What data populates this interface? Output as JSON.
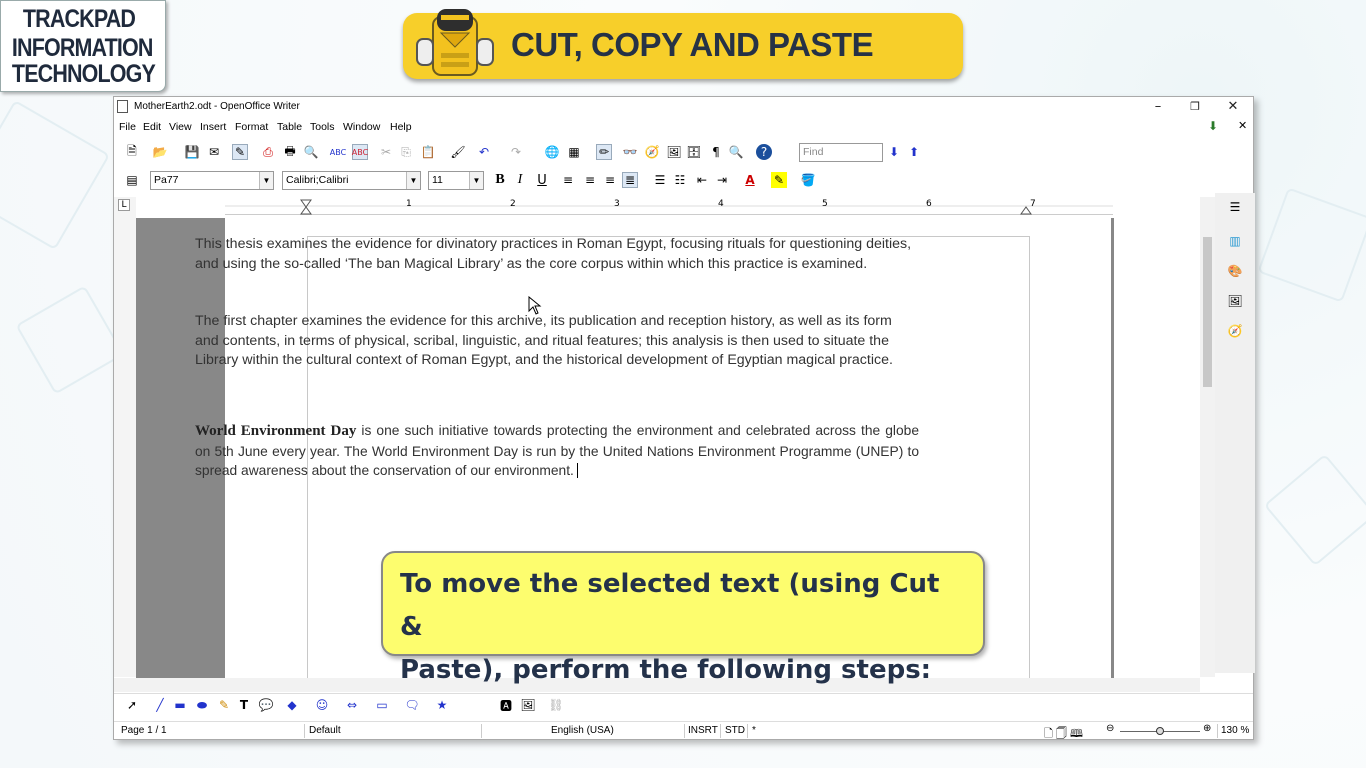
{
  "branding": {
    "logo_line1": "TRACKPAD",
    "logo_line2": "INFORMATION",
    "logo_line3": "TECHNOLOGY",
    "banner_title": "CUT, COPY AND PASTE"
  },
  "window": {
    "title": "MotherEarth2.odt - OpenOffice Writer",
    "minimize": "–",
    "restore": "❐",
    "close": "✕",
    "doc_close": "✕"
  },
  "menu": [
    "File",
    "Edit",
    "View",
    "Insert",
    "Format",
    "Table",
    "Tools",
    "Window",
    "Help"
  ],
  "toolbar": {
    "find_placeholder": "Find"
  },
  "formatting": {
    "style": "Pa77",
    "font": "Calibri;Calibri",
    "size": "11",
    "bold": "B",
    "italic": "I",
    "underline": "U"
  },
  "ruler": {
    "numbers": [
      "1",
      "2",
      "3",
      "4",
      "5",
      "6",
      "7"
    ]
  },
  "document": {
    "para1": "This thesis examines the evidence for divinatory practices in Roman Egypt, focusing rituals for questioning deities, and using the so-called ‘The ban Magical Library’ as the core corpus within which this practice is examined.",
    "para2": "The first chapter examines the evidence for this archive, its publication and reception history, as well as its form and contents, in terms of physical, scribal, linguistic, and ritual features; this analysis is then used to situate the Library within the cultural context of Roman Egypt, and the historical development of Egyptian magical practice.",
    "para3_bold": "World Environment Day",
    "para3_rest": " is one such initiative towards protecting the environment and celebrated across the globe on 5th June every year. The World Environment Day is run by the United Nations Environment Programme (UNEP) to spread awareness about the conservation of our environment."
  },
  "callout": {
    "line1": "To move the selected text (using Cut &",
    "line2": "Paste), perform the following steps:"
  },
  "status": {
    "page": "Page 1 / 1",
    "style": "Default",
    "language": "English (USA)",
    "insert_mode": "INSRT",
    "selection_mode": "STD",
    "modified": "*",
    "zoom": "130 %"
  }
}
